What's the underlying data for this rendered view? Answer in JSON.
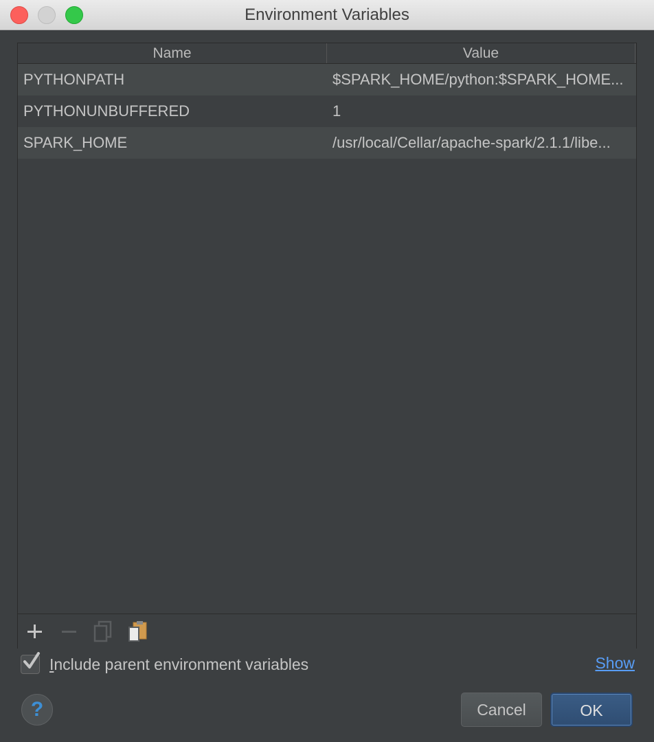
{
  "window": {
    "title": "Environment Variables"
  },
  "table": {
    "columns": [
      "Name",
      "Value"
    ],
    "rows": [
      {
        "name": "PYTHONPATH",
        "value": "$SPARK_HOME/python:$SPARK_HOME..."
      },
      {
        "name": "PYTHONUNBUFFERED",
        "value": "1"
      },
      {
        "name": "SPARK_HOME",
        "value": "/usr/local/Cellar/apache-spark/2.1.1/libe..."
      }
    ]
  },
  "toolbar": {
    "add_icon": "plus-icon",
    "remove_icon": "minus-icon",
    "copy_icon": "copy-icon",
    "paste_icon": "paste-icon"
  },
  "options": {
    "include_parent_label_mnemonic": "I",
    "include_parent_label_rest": "nclude parent environment variables",
    "include_parent_checked": true,
    "show_link": "Show"
  },
  "footer": {
    "help_label": "?",
    "cancel_label": "Cancel",
    "ok_label": "OK"
  },
  "colors": {
    "background": "#3c3f41",
    "link": "#589df6",
    "ok_button": "#2f4d72"
  }
}
